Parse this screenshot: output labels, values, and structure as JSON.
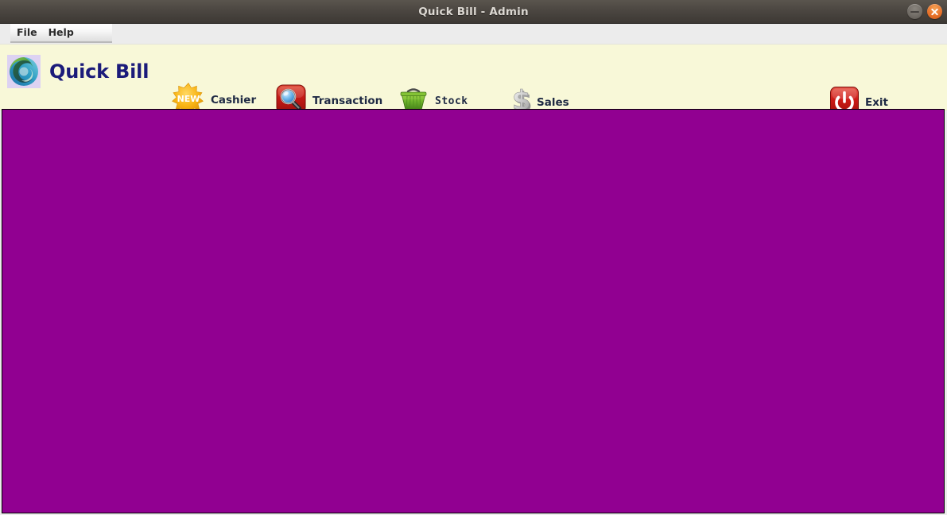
{
  "window": {
    "title": "Quick Bill - Admin",
    "controls": [
      {
        "name": "minimize",
        "glyph": "–"
      },
      {
        "name": "close",
        "glyph": "✕"
      }
    ]
  },
  "menubar": {
    "items": [
      {
        "label": "File"
      },
      {
        "label": "Help"
      }
    ]
  },
  "brand": {
    "title": "Quick Bill",
    "logo_icon": "quick-bill-swirl-logo"
  },
  "toolbar": {
    "items": [
      {
        "label": "Cashier",
        "icon": "new-starburst-icon",
        "badge": "NEW"
      },
      {
        "label": "Transaction",
        "icon": "magnifier-search-icon"
      },
      {
        "label": "Stock",
        "icon": "shopping-basket-icon"
      },
      {
        "label": "Sales",
        "icon": "dollar-sign-3d-icon"
      },
      {
        "label": "Exit",
        "icon": "power-off-icon"
      }
    ]
  },
  "content": {
    "background_color": "#910091",
    "placeholder_text": ""
  },
  "colors": {
    "titlebar_dark": "#4b4641",
    "toolbar_bg": "#f8f8d8",
    "brand_text": "#1b1b7a",
    "content_purple": "#910091",
    "close_button": "#e8732b",
    "menubar_bg": "#ececec"
  }
}
